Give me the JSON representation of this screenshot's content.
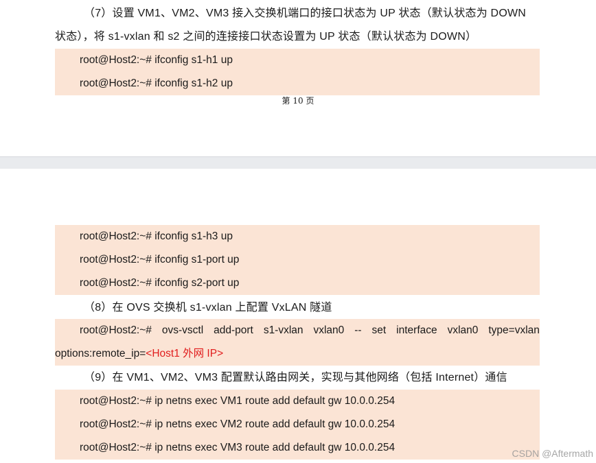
{
  "step7": {
    "line1": "（7）设置 VM1、VM2、VM3 接入交换机端口的接口状态为 UP 状态（默认状态为 DOWN",
    "line2": "状态），将 s1-vxlan 和 s2 之间的连接接口状态设置为 UP 状态（默认状态为 DOWN）"
  },
  "code7a": [
    "root@Host2:~# ifconfig s1-h1 up",
    "root@Host2:~# ifconfig s1-h2 up"
  ],
  "page_number": "第  10  页",
  "code7b": [
    "root@Host2:~# ifconfig s1-h3 up",
    "root@Host2:~# ifconfig s1-port up",
    "root@Host2:~# ifconfig s2-port up"
  ],
  "step8": "（8）在 OVS 交换机 s1-vxlan 上配置 VxLAN 隧道",
  "code8": {
    "line1_parts": [
      "root@Host2:~#",
      "ovs-vsctl",
      "add-port",
      "s1-vxlan",
      "vxlan0",
      "--",
      "set",
      "interface",
      "vxlan0",
      "type=vxlan"
    ],
    "line2_prefix": "options:remote_ip=",
    "line2_highlight": "<Host1 外网 IP>"
  },
  "step9": "（9）在 VM1、VM2、VM3 配置默认路由网关，实现与其他网络（包括 Internet）通信",
  "code9": [
    "root@Host2:~# ip netns exec VM1 route add default gw 10.0.0.254",
    "root@Host2:~# ip netns exec VM2 route add default gw 10.0.0.254",
    "root@Host2:~# ip netns exec VM3 route add default gw 10.0.0.254"
  ],
  "watermark": "CSDN @Aftermath",
  "colors": {
    "code_bg": "#fbe4d5",
    "highlight": "#e11d1d",
    "page_gap": "#e9ebee"
  }
}
